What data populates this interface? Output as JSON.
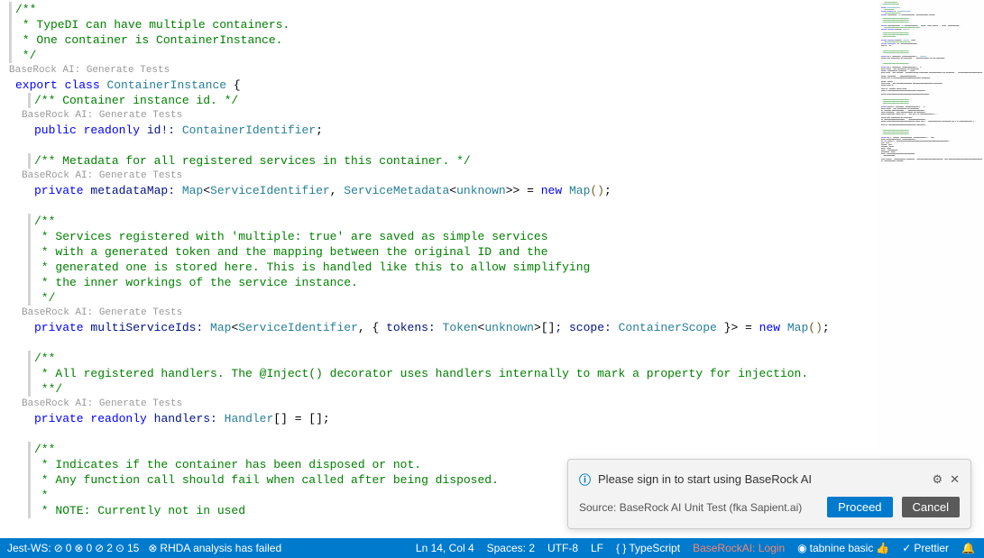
{
  "code": {
    "c1": "/**",
    "c2": " * TypeDI can have multiple containers.",
    "c3": " * One container is ContainerInstance.",
    "c4": " */",
    "codelens": "BaseRock AI: Generate Tests",
    "export": "export",
    "class": "class",
    "className": "ContainerInstance",
    "openBrace": " {",
    "c5": "/** Container instance id. */",
    "public": "public",
    "readonly": "readonly",
    "idField": " id!: ",
    "containerIdentifier": "ContainerIdentifier",
    "semi": ";",
    "c6": "/** Metadata for all registered services in this container. */",
    "private": "private",
    "metadataMap": " metadataMap: ",
    "mapType": "Map",
    "angleOpen": "<",
    "serviceIdentifier": "ServiceIdentifier",
    "comma": ", ",
    "serviceMetadata": "ServiceMetadata",
    "unknown": "unknown",
    "angleClose": ">",
    "doubleClose": ">>",
    "equals": " = ",
    "new": "new",
    "parens": "()",
    "c7a": "/**",
    "c7b": " * Services registered with 'multiple: true' are saved as simple services",
    "c7c": " * with a generated token and the mapping between the original ID and the",
    "c7d": " * generated one is stored here. This is handled like this to allow simplifying",
    "c7e": " * the inner workings of the service instance.",
    "c7f": " */",
    "multiServiceIds": " multiServiceIds: ",
    "braceOpen": "{ ",
    "tokens": "tokens: ",
    "token": "Token",
    "brackets": "[]",
    "scope": "; scope: ",
    "containerScope": "ContainerScope",
    "braceClose": " }",
    "c8a": "/**",
    "c8b": " * All registered handlers. The @Inject() decorator uses handlers internally to mark a property for injection.",
    "c8c": " **/",
    "handlers": " handlers: ",
    "handler": "Handler",
    "emptyArr": " = []",
    "c9a": "/**",
    "c9b": " * Indicates if the container has been disposed or not.",
    "c9c": " * Any function call should fail when called after being disposed.",
    "c9d": " *",
    "c9e": " * NOTE: Currently not in used"
  },
  "notification": {
    "title": "Please sign in to start using BaseRock AI",
    "source": "Source: BaseRock AI Unit Test (fka Sapient.ai)",
    "proceed": "Proceed",
    "cancel": "Cancel"
  },
  "statusbar": {
    "jest": "Jest-WS:",
    "j1": "0",
    "j2": "0",
    "j3": "2",
    "j4": "15",
    "rhda": "RHDA analysis has failed",
    "pos": "Ln 14, Col 4",
    "spaces": "Spaces: 2",
    "encoding": "UTF-8",
    "eol": "LF",
    "lang": "TypeScript",
    "baserock": "BaseRockAI: Login",
    "tabnine": "tabnine basic",
    "prettier": "Prettier"
  }
}
